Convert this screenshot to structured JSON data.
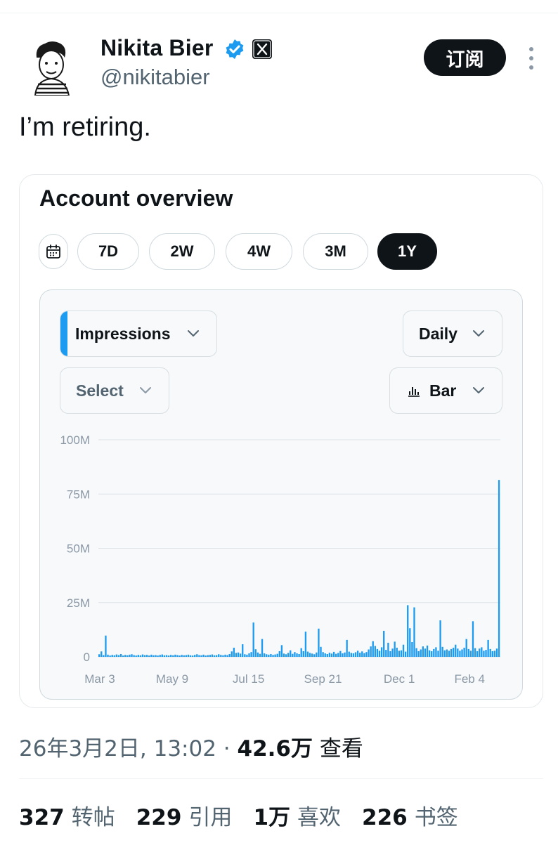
{
  "author": {
    "name": "Nikita Bier",
    "handle": "@nikitabier",
    "verified_color": "#1d9bf0"
  },
  "subscribe_label": "订阅",
  "tweet_text": "I’m retiring.",
  "overview": {
    "title": "Account overview",
    "ranges": [
      "7D",
      "2W",
      "4W",
      "3M",
      "1Y"
    ],
    "active_range": "1Y",
    "metric": "Impressions",
    "compare_placeholder": "Select",
    "interval": "Daily",
    "chart_type_label": "Bar"
  },
  "chart_data": {
    "type": "bar",
    "series": [
      {
        "name": "Impressions",
        "color": "#1d9bf0"
      }
    ],
    "ylim": [
      0,
      100000000
    ],
    "y_ticks": [
      "0",
      "25M",
      "50M",
      "75M",
      "100M"
    ],
    "x_ticks": [
      "Mar 3",
      "May 9",
      "Jul 15",
      "Sep 21",
      "Dec 1",
      "Feb 4"
    ],
    "grid": true,
    "values_millions": [
      1.2,
      2.5,
      0.8,
      9.8,
      1.0,
      0.6,
      0.9,
      0.7,
      1.1,
      0.8,
      1.3,
      0.6,
      0.9,
      0.7,
      1.0,
      1.2,
      0.8,
      0.6,
      0.9,
      0.7,
      1.1,
      0.8,
      0.9,
      0.6,
      1.0,
      0.7,
      0.8,
      0.6,
      0.9,
      1.1,
      0.7,
      0.8,
      0.6,
      0.9,
      0.7,
      1.0,
      0.8,
      0.6,
      0.9,
      0.7,
      0.8,
      1.0,
      0.7,
      0.6,
      0.9,
      1.2,
      0.8,
      0.7,
      1.0,
      0.6,
      0.8,
      0.9,
      1.1,
      0.7,
      0.8,
      1.2,
      0.9,
      0.7,
      1.0,
      0.8,
      1.3,
      2.5,
      4.2,
      1.8,
      2.0,
      1.5,
      5.8,
      1.2,
      1.0,
      1.6,
      2.2,
      15.8,
      3.5,
      2.0,
      1.4,
      8.2,
      1.6,
      1.2,
      1.0,
      1.3,
      0.9,
      1.1,
      1.4,
      2.6,
      5.4,
      1.5,
      1.2,
      1.8,
      3.0,
      1.4,
      2.2,
      1.6,
      1.3,
      4.0,
      2.6,
      11.6,
      2.4,
      1.8,
      1.5,
      1.2,
      2.0,
      13.0,
      4.6,
      2.2,
      1.6,
      1.3,
      1.9,
      1.5,
      2.3,
      1.4,
      1.8,
      2.7,
      1.6,
      2.0,
      7.8,
      2.4,
      1.8,
      1.6,
      2.1,
      2.8,
      1.9,
      2.5,
      1.7,
      2.2,
      3.4,
      4.8,
      7.2,
      5.0,
      3.6,
      2.8,
      4.4,
      12.0,
      3.2,
      6.5,
      2.6,
      3.8,
      7.0,
      4.2,
      2.8,
      3.0,
      5.6,
      2.4,
      23.8,
      13.2,
      6.8,
      22.8,
      4.0,
      2.6,
      3.4,
      4.8,
      3.8,
      5.2,
      3.0,
      2.6,
      3.6,
      4.4,
      2.8,
      16.8,
      4.6,
      3.0,
      3.4,
      2.8,
      3.6,
      4.2,
      5.6,
      3.8,
      2.8,
      3.4,
      4.2,
      8.2,
      3.6,
      2.8,
      16.4,
      4.0,
      2.6,
      3.8,
      4.4,
      2.8,
      3.2,
      7.8,
      3.6,
      2.6,
      2.8,
      3.8,
      81.5
    ]
  },
  "footer": {
    "timestamp": "26年3月2日, 13:02",
    "separator": "·",
    "views_count": "42.6万",
    "views_label": "查看",
    "stats": [
      {
        "num": "327",
        "label": "转帖"
      },
      {
        "num": "229",
        "label": "引用"
      },
      {
        "num": "1万",
        "label": "喜欢"
      },
      {
        "num": "226",
        "label": "书签"
      }
    ]
  }
}
